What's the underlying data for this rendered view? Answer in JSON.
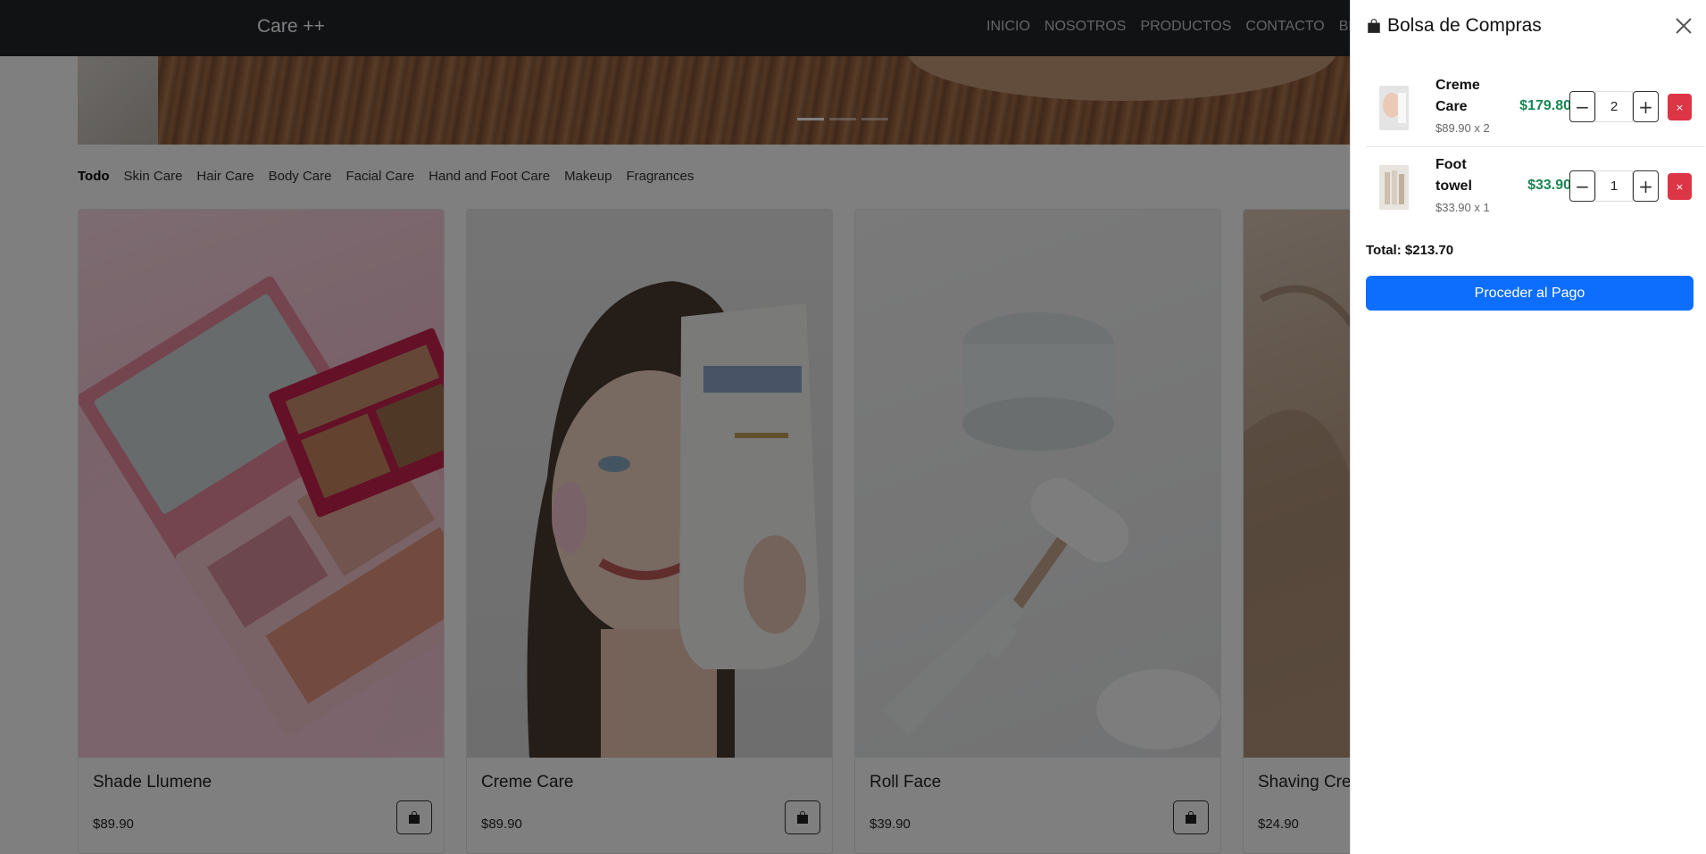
{
  "navbar": {
    "brand": "Care ++",
    "links": [
      "INICIO",
      "NOSOTROS",
      "PRODUCTOS",
      "CONTACTO",
      "BLOG"
    ]
  },
  "categories": {
    "items": [
      "Todo",
      "Skin Care",
      "Hair Care",
      "Body Care",
      "Facial Care",
      "Hand and Foot Care",
      "Makeup",
      "Fragrances"
    ],
    "active": "Todo"
  },
  "products": [
    {
      "name": "Shade Llumene",
      "price": "$89.90",
      "image": "makeup-palette"
    },
    {
      "name": "Creme Care",
      "price": "$89.90",
      "image": "woman-with-cream-tube"
    },
    {
      "name": "Roll Face",
      "price": "$39.90",
      "image": "face-roller-and-jar"
    },
    {
      "name": "Shaving Cream",
      "price": "$24.90",
      "image": "fabric-texture"
    }
  ],
  "cart": {
    "title": "Bolsa de Compras",
    "items": [
      {
        "name": "Creme Care",
        "unit_label": "$89.90 x 2",
        "quantity": "2",
        "line_total": "$179.80"
      },
      {
        "name": "Foot towel",
        "unit_label": "$33.90 x 1",
        "quantity": "1",
        "line_total": "$33.90"
      }
    ],
    "total_label": "Total: $213.70",
    "checkout_label": "Proceder al Pago",
    "remove_glyph": "×",
    "minus_glyph": "−",
    "plus_glyph": "+"
  },
  "colors": {
    "navbar_bg": "#212529",
    "primary": "#0d6efd",
    "success": "#198754",
    "danger": "#dc3545"
  }
}
